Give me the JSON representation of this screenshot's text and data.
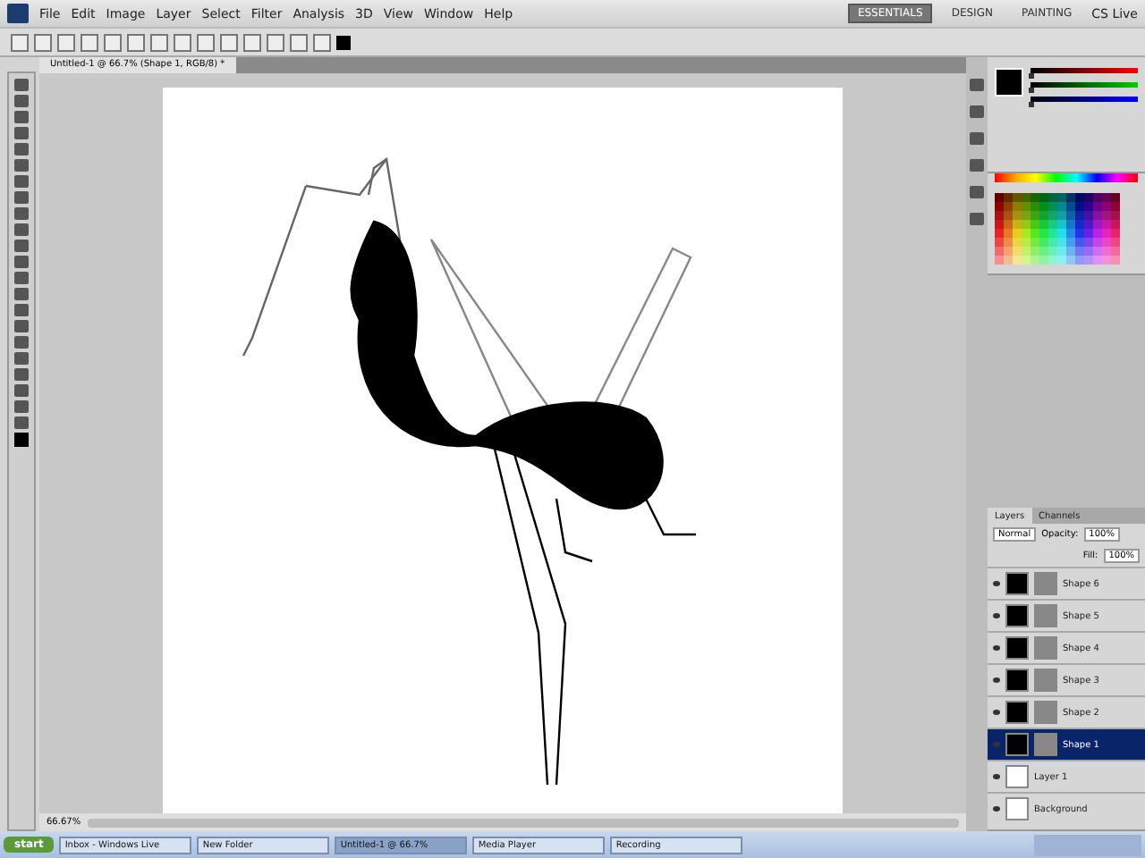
{
  "menu": [
    "File",
    "Edit",
    "Image",
    "Layer",
    "Select",
    "Filter",
    "Analysis",
    "3D",
    "View",
    "Window",
    "Help"
  ],
  "workspaces": [
    {
      "label": "ESSENTIALS",
      "selected": true
    },
    {
      "label": "DESIGN",
      "selected": false
    },
    {
      "label": "PAINTING",
      "selected": false
    }
  ],
  "cs_live": "CS Live",
  "color_channels": [
    {
      "kind": "red",
      "level": 0
    },
    {
      "kind": "green",
      "level": 0
    },
    {
      "kind": "blue",
      "level": 0
    }
  ],
  "document_tab": {
    "title": "Untitled-1 @ 66.7% (Shape 1, RGB/8) *"
  },
  "layers_panel": {
    "tabs": [
      {
        "label": "Layers",
        "selected": true
      },
      {
        "label": "Channels",
        "selected": false
      }
    ],
    "blend_mode": "Normal",
    "opacity_label": "Opacity:",
    "opacity": "100%",
    "fill_label": "Fill:",
    "fill": "100%",
    "layers": [
      {
        "name": "Shape 6",
        "kind": "shape",
        "visible": true,
        "selected": false
      },
      {
        "name": "Shape 5",
        "kind": "shape",
        "visible": true,
        "selected": false
      },
      {
        "name": "Shape 4",
        "kind": "shape",
        "visible": true,
        "selected": false
      },
      {
        "name": "Shape 3",
        "kind": "shape",
        "visible": true,
        "selected": false
      },
      {
        "name": "Shape 2",
        "kind": "shape",
        "visible": true,
        "selected": false
      },
      {
        "name": "Shape 1",
        "kind": "shape",
        "visible": true,
        "selected": true
      },
      {
        "name": "Layer 1",
        "kind": "pixel",
        "visible": true,
        "selected": false
      },
      {
        "name": "Background",
        "kind": "background",
        "visible": true,
        "selected": false
      }
    ]
  },
  "status_bar": {
    "zoom": "66.67%"
  },
  "taskbar": {
    "start": "start",
    "tasks": [
      {
        "label": "Inbox - Windows Live",
        "selected": false
      },
      {
        "label": "New Folder",
        "selected": false
      },
      {
        "label": "Untitled-1 @ 66.7%",
        "selected": true
      },
      {
        "label": "Media Player",
        "selected": false
      },
      {
        "label": "Recording",
        "selected": false
      }
    ]
  }
}
